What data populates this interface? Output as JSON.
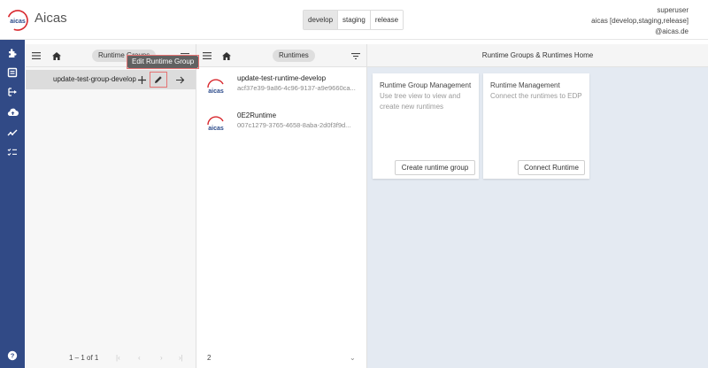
{
  "app": {
    "title": "Aicas",
    "logo_text": "aicas"
  },
  "environments": [
    {
      "label": "develop",
      "active": true
    },
    {
      "label": "staging",
      "active": false
    },
    {
      "label": "release",
      "active": false
    }
  ],
  "user": {
    "name": "superuser",
    "org": "aicas [develop,staging,release]",
    "email": "@aicas.de"
  },
  "sidebar": {
    "items": [
      {
        "icon": "puzzle-icon"
      },
      {
        "icon": "dashboard-icon"
      },
      {
        "icon": "deploy-icon"
      },
      {
        "icon": "cloud-upload-icon"
      },
      {
        "icon": "analytics-icon"
      },
      {
        "icon": "checklist-icon"
      }
    ],
    "help_icon": "help-icon"
  },
  "groups_panel": {
    "chip_label": "Runtime Groups",
    "tooltip": "Edit Runtime Group",
    "row_label": "update-test-group-develop",
    "pagination": "1 – 1 of 1"
  },
  "runtimes_panel": {
    "chip_label": "Runtimes",
    "items": [
      {
        "name": "update-test-runtime-develop",
        "id": "acf37e39-9a86-4c96-9137-a9e9660ca..."
      },
      {
        "name": "0E2Runtime",
        "id": "007c1279-3765-4658-8aba-2d0f3f9d..."
      }
    ],
    "count": "2"
  },
  "home_panel": {
    "title": "Runtime Groups & Runtimes Home",
    "cards": [
      {
        "title": "Runtime Group Management",
        "desc": "Use tree view to view and create new runtimes",
        "button": "Create runtime group"
      },
      {
        "title": "Runtime Management",
        "desc": "Connect the runtimes to EDP",
        "button": "Connect Runtime"
      }
    ]
  },
  "colors": {
    "sidebar": "#314a86",
    "accent": "#e57373",
    "home_bg": "#e4eaf2"
  }
}
